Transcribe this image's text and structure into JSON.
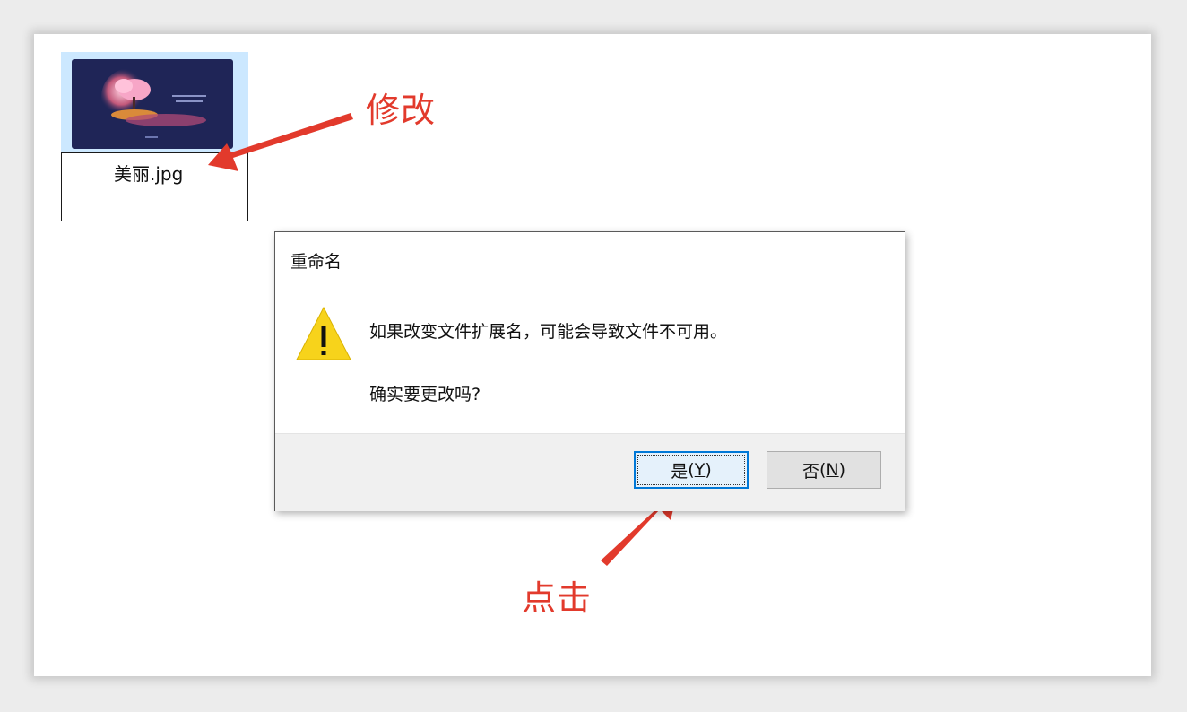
{
  "file": {
    "name": "美丽.jpg",
    "thumbnail": "night-scene-thumbnail"
  },
  "annotations": {
    "top_label": "修改",
    "bottom_label": "点击",
    "color": "#e23a2c"
  },
  "dialog": {
    "title": "重命名",
    "icon": "warning-icon",
    "message_line1": "如果改变文件扩展名，可能会导致文件不可用。",
    "message_line2": "确实要更改吗?",
    "yes_text": "是",
    "yes_key": "Y",
    "no_text": "否",
    "no_key": "N"
  }
}
